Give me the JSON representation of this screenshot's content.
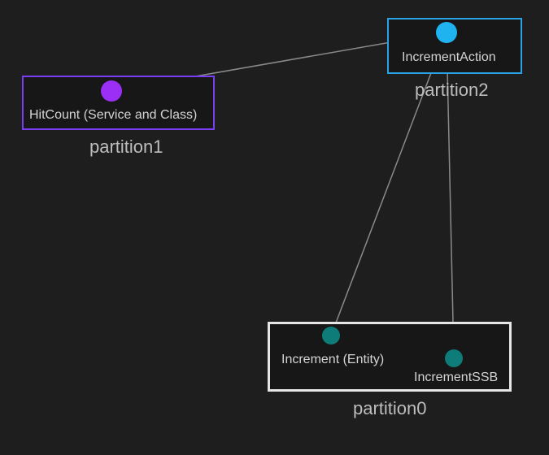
{
  "diagram": {
    "partitions": {
      "p0": {
        "label": "partition0",
        "border_color": "#e6e6e6"
      },
      "p1": {
        "label": "partition1",
        "border_color": "#7a3ef2"
      },
      "p2": {
        "label": "partition2",
        "border_color": "#29a3e6"
      }
    },
    "nodes": {
      "hitcount": {
        "label": "HitCount (Service and Class)",
        "color": "#9b2ff5",
        "partition": "p1"
      },
      "increment_action": {
        "label": "IncrementAction",
        "color": "#1fb4ef",
        "partition": "p2"
      },
      "increment_entity": {
        "label": "Increment (Entity)",
        "color": "#0e7c78",
        "partition": "p0"
      },
      "increment_ssb": {
        "label": "IncrementSSB",
        "color": "#0e7c78",
        "partition": "p0"
      }
    },
    "edges": [
      {
        "from": "hitcount",
        "to": "increment_action"
      },
      {
        "from": "increment_action",
        "to": "increment_entity"
      },
      {
        "from": "increment_action",
        "to": "increment_ssb"
      },
      {
        "from": "increment_entity",
        "to": "increment_ssb"
      }
    ],
    "edge_color": "#8a8a8a"
  }
}
